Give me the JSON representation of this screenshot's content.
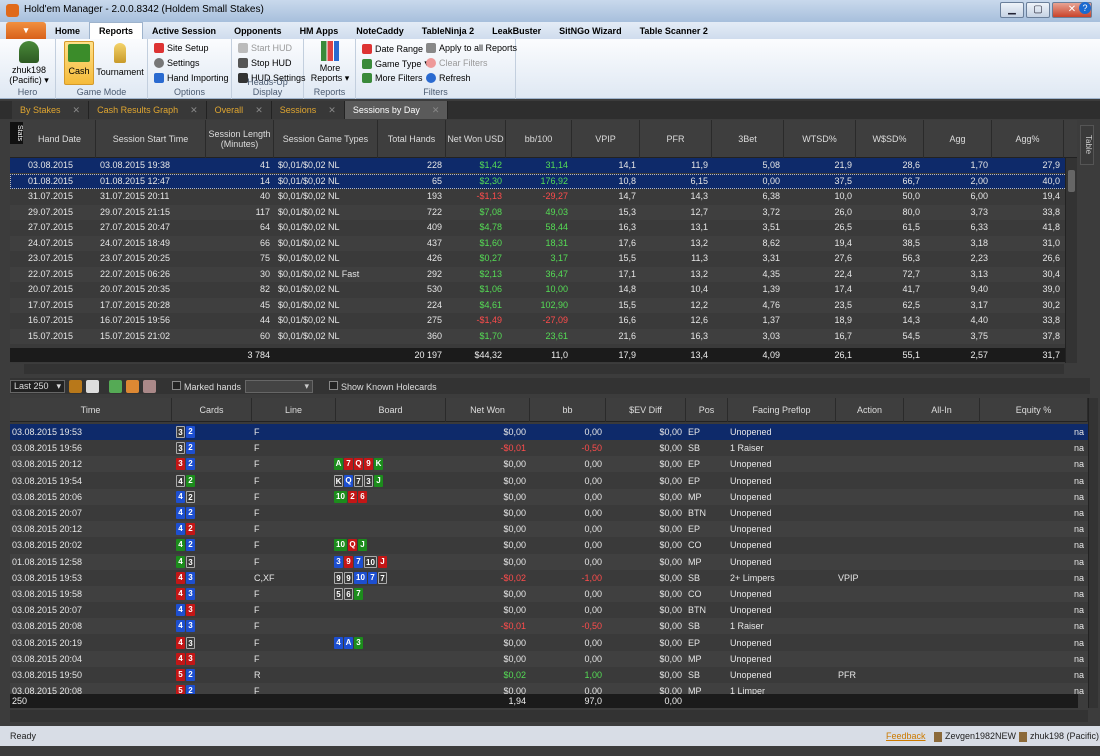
{
  "window": {
    "title": "Hold'em Manager - 2.0.0.8342 (Holdem Small Stakes)",
    "min": "▁",
    "max": "▢",
    "close": "✕"
  },
  "menu_tabs": [
    "Home",
    "Reports",
    "Active Session",
    "Opponents",
    "HM Apps",
    "NoteCaddy",
    "TableNinja 2",
    "LeakBuster",
    "SitNGo Wizard",
    "Table Scanner 2"
  ],
  "active_menu_tab": "Reports",
  "help_label": "?",
  "app_button_label": "▾",
  "ribbon": {
    "hero": {
      "name": "zhuk198",
      "site": "(Pacific)",
      "caption": "Hero"
    },
    "game_mode": {
      "cash": "Cash",
      "tournament": "Tournament",
      "caption": "Game Mode"
    },
    "options": {
      "site_setup": "Site Setup",
      "settings": "Settings",
      "hand_importing": "Hand Importing",
      "caption": "Options"
    },
    "hud": {
      "start": "Start HUD",
      "stop": "Stop HUD",
      "settings": "HUD Settings",
      "caption": "Heads-Up Display"
    },
    "reports": {
      "more": "More",
      "reports_label": "Reports",
      "caption": "Reports"
    },
    "filters": {
      "date_range": "Date Range",
      "game_type": "Game Type",
      "more_filters": "More Filters",
      "apply_all": "Apply to all Reports",
      "clear": "Clear Filters",
      "refresh": "Refresh",
      "caption": "Filters"
    }
  },
  "doc_tabs": [
    "By Stakes",
    "Cash Results Graph",
    "Overall",
    "Sessions",
    "Sessions by Day"
  ],
  "active_doc_tab": "Sessions by Day",
  "stats_label": "Stats",
  "table_label": "Table",
  "sessions_table": {
    "columns": [
      "Hand Date",
      "Session Start Time",
      "Session Length (Minutes)",
      "Session Game Types",
      "Total Hands",
      "Net Won USD",
      "bb/100",
      "VPIP",
      "PFR",
      "3Bet",
      "WTSD%",
      "W$SD%",
      "Agg",
      "Agg%"
    ],
    "rows": [
      [
        "03.08.2015",
        "03.08.2015 19:38",
        "41",
        "$0,01/$0,02 NL",
        "228",
        "$1,42",
        "31,14",
        "14,1",
        "11,9",
        "5,08",
        "21,9",
        "28,6",
        "1,70",
        "27,9"
      ],
      [
        "01.08.2015",
        "01.08.2015 12:47",
        "14",
        "$0,01/$0,02 NL",
        "65",
        "$2,30",
        "176,92",
        "10,8",
        "6,15",
        "0,00",
        "37,5",
        "66,7",
        "2,00",
        "40,0"
      ],
      [
        "31.07.2015",
        "31.07.2015 20:11",
        "40",
        "$0,01/$0,02 NL",
        "193",
        "-$1,13",
        "-29,27",
        "14,7",
        "14,3",
        "6,38",
        "10,0",
        "50,0",
        "6,00",
        "19,4"
      ],
      [
        "29.07.2015",
        "29.07.2015 21:15",
        "117",
        "$0,01/$0,02 NL",
        "722",
        "$7,08",
        "49,03",
        "15,3",
        "12,7",
        "3,72",
        "26,0",
        "80,0",
        "3,73",
        "33,8"
      ],
      [
        "27.07.2015",
        "27.07.2015 20:47",
        "64",
        "$0,01/$0,02 NL",
        "409",
        "$4,78",
        "58,44",
        "16,3",
        "13,1",
        "3,51",
        "26,5",
        "61,5",
        "6,33",
        "41,8"
      ],
      [
        "24.07.2015",
        "24.07.2015 18:49",
        "66",
        "$0,01/$0,02 NL",
        "437",
        "$1,60",
        "18,31",
        "17,6",
        "13,2",
        "8,62",
        "19,4",
        "38,5",
        "3,18",
        "31,0"
      ],
      [
        "23.07.2015",
        "23.07.2015 20:25",
        "75",
        "$0,01/$0,02 NL",
        "426",
        "$0,27",
        "3,17",
        "15,5",
        "11,3",
        "3,31",
        "27,6",
        "56,3",
        "2,23",
        "26,6"
      ],
      [
        "22.07.2015",
        "22.07.2015 06:26",
        "30",
        "$0,01/$0,02 NL Fast",
        "292",
        "$2,13",
        "36,47",
        "17,1",
        "13,2",
        "4,35",
        "22,4",
        "72,7",
        "3,13",
        "30,4"
      ],
      [
        "20.07.2015",
        "20.07.2015 20:35",
        "82",
        "$0,01/$0,02 NL",
        "530",
        "$1,06",
        "10,00",
        "14,8",
        "10,4",
        "1,39",
        "17,4",
        "41,7",
        "9,40",
        "39,0"
      ],
      [
        "17.07.2015",
        "17.07.2015 20:28",
        "45",
        "$0,01/$0,02 NL",
        "224",
        "$4,61",
        "102,90",
        "15,5",
        "12,2",
        "4,76",
        "23,5",
        "62,5",
        "3,17",
        "30,2"
      ],
      [
        "16.07.2015",
        "16.07.2015 19:56",
        "44",
        "$0,01/$0,02 NL",
        "275",
        "-$1,49",
        "-27,09",
        "16,6",
        "12,6",
        "1,37",
        "18,9",
        "14,3",
        "4,40",
        "33,8"
      ],
      [
        "15.07.2015",
        "15.07.2015 21:02",
        "60",
        "$0,01/$0,02 NL",
        "360",
        "$1,70",
        "23,61",
        "21,6",
        "16,3",
        "3,03",
        "16,7",
        "54,5",
        "3,75",
        "37,8"
      ]
    ],
    "totals": [
      "",
      "",
      "3 784",
      "",
      "20 197",
      "$44,32",
      "11,0",
      "17,9",
      "13,4",
      "4,09",
      "26,1",
      "55,1",
      "2,57",
      "31,7"
    ]
  },
  "hands_toolbar": {
    "limit": "Last 250",
    "marked_hands": "Marked hands",
    "show_known": "Show Known Holecards"
  },
  "hands_table": {
    "columns": [
      "Time",
      "Cards",
      "Line",
      "Board",
      "Net Won",
      "bb",
      "$EV Diff",
      "Pos",
      "Facing Preflop",
      "Action",
      "All-In",
      "Equity %"
    ],
    "rows": [
      {
        "time": "03.08.2015 19:53",
        "cards": [
          [
            "3",
            "s"
          ],
          [
            "2",
            "d"
          ]
        ],
        "line": "F",
        "board": [],
        "net": "$0,00",
        "bb": "0,00",
        "ev": "$0,00",
        "pos": "EP",
        "facing": "Unopened",
        "action": "",
        "allin": "",
        "eq": "na"
      },
      {
        "time": "03.08.2015 19:56",
        "cards": [
          [
            "3",
            "s"
          ],
          [
            "2",
            "d"
          ]
        ],
        "line": "F",
        "board": [],
        "net": "-$0,01",
        "bb": "-0,50",
        "ev": "$0,00",
        "pos": "SB",
        "facing": "1 Raiser",
        "action": "",
        "allin": "",
        "eq": "na"
      },
      {
        "time": "03.08.2015 20:12",
        "cards": [
          [
            "3",
            "h"
          ],
          [
            "2",
            "d"
          ]
        ],
        "line": "F",
        "board": [
          [
            "A",
            "c2"
          ],
          [
            "7",
            "h"
          ],
          [
            "Q",
            "h"
          ],
          [
            "9",
            "h"
          ],
          [
            "K",
            "c2"
          ]
        ],
        "net": "$0,00",
        "bb": "0,00",
        "ev": "$0,00",
        "pos": "EP",
        "facing": "Unopened",
        "action": "",
        "allin": "",
        "eq": "na"
      },
      {
        "time": "03.08.2015 19:54",
        "cards": [
          [
            "4",
            "s"
          ],
          [
            "2",
            "c2"
          ]
        ],
        "line": "F",
        "board": [
          [
            "K",
            "s"
          ],
          [
            "Q",
            "d"
          ],
          [
            "7",
            "s"
          ],
          [
            "3",
            "s"
          ],
          [
            "J",
            "c2"
          ]
        ],
        "net": "$0,00",
        "bb": "0,00",
        "ev": "$0,00",
        "pos": "EP",
        "facing": "Unopened",
        "action": "",
        "allin": "",
        "eq": "na"
      },
      {
        "time": "03.08.2015 20:06",
        "cards": [
          [
            "4",
            "d"
          ],
          [
            "2",
            "s"
          ]
        ],
        "line": "F",
        "board": [
          [
            "10",
            "c2"
          ],
          [
            "2",
            "h"
          ],
          [
            "6",
            "h"
          ]
        ],
        "net": "$0,00",
        "bb": "0,00",
        "ev": "$0,00",
        "pos": "MP",
        "facing": "Unopened",
        "action": "",
        "allin": "",
        "eq": "na"
      },
      {
        "time": "03.08.2015 20:07",
        "cards": [
          [
            "4",
            "d"
          ],
          [
            "2",
            "d"
          ]
        ],
        "line": "F",
        "board": [],
        "net": "$0,00",
        "bb": "0,00",
        "ev": "$0,00",
        "pos": "BTN",
        "facing": "Unopened",
        "action": "",
        "allin": "",
        "eq": "na"
      },
      {
        "time": "03.08.2015 20:12",
        "cards": [
          [
            "4",
            "d"
          ],
          [
            "2",
            "h"
          ]
        ],
        "line": "F",
        "board": [],
        "net": "$0,00",
        "bb": "0,00",
        "ev": "$0,00",
        "pos": "EP",
        "facing": "Unopened",
        "action": "",
        "allin": "",
        "eq": "na"
      },
      {
        "time": "03.08.2015 20:02",
        "cards": [
          [
            "4",
            "c2"
          ],
          [
            "2",
            "d"
          ]
        ],
        "line": "F",
        "board": [
          [
            "10",
            "c2"
          ],
          [
            "Q",
            "h"
          ],
          [
            "J",
            "c2"
          ]
        ],
        "net": "$0,00",
        "bb": "0,00",
        "ev": "$0,00",
        "pos": "CO",
        "facing": "Unopened",
        "action": "",
        "allin": "",
        "eq": "na"
      },
      {
        "time": "01.08.2015 12:58",
        "cards": [
          [
            "4",
            "c2"
          ],
          [
            "3",
            "s"
          ]
        ],
        "line": "F",
        "board": [
          [
            "3",
            "d"
          ],
          [
            "9",
            "h"
          ],
          [
            "7",
            "d"
          ],
          [
            "10",
            "s"
          ],
          [
            "J",
            "h"
          ]
        ],
        "net": "$0,00",
        "bb": "0,00",
        "ev": "$0,00",
        "pos": "MP",
        "facing": "Unopened",
        "action": "",
        "allin": "",
        "eq": "na"
      },
      {
        "time": "03.08.2015 19:53",
        "cards": [
          [
            "4",
            "h"
          ],
          [
            "3",
            "d"
          ]
        ],
        "line": "C,XF",
        "board": [
          [
            "9",
            "s"
          ],
          [
            "9",
            "s"
          ],
          [
            "10",
            "d"
          ],
          [
            "7",
            "d"
          ],
          [
            "7",
            "s"
          ]
        ],
        "net": "-$0,02",
        "bb": "-1,00",
        "ev": "$0,00",
        "pos": "SB",
        "facing": "2+ Limpers",
        "action": "VPIP",
        "allin": "",
        "eq": "na"
      },
      {
        "time": "03.08.2015 19:58",
        "cards": [
          [
            "4",
            "h"
          ],
          [
            "3",
            "d"
          ]
        ],
        "line": "F",
        "board": [
          [
            "5",
            "s"
          ],
          [
            "6",
            "s"
          ],
          [
            "7",
            "c2"
          ]
        ],
        "net": "$0,00",
        "bb": "0,00",
        "ev": "$0,00",
        "pos": "CO",
        "facing": "Unopened",
        "action": "",
        "allin": "",
        "eq": "na"
      },
      {
        "time": "03.08.2015 20:07",
        "cards": [
          [
            "4",
            "d"
          ],
          [
            "3",
            "h"
          ]
        ],
        "line": "F",
        "board": [],
        "net": "$0,00",
        "bb": "0,00",
        "ev": "$0,00",
        "pos": "BTN",
        "facing": "Unopened",
        "action": "",
        "allin": "",
        "eq": "na"
      },
      {
        "time": "03.08.2015 20:08",
        "cards": [
          [
            "4",
            "d"
          ],
          [
            "3",
            "d"
          ]
        ],
        "line": "F",
        "board": [],
        "net": "-$0,01",
        "bb": "-0,50",
        "ev": "$0,00",
        "pos": "SB",
        "facing": "1 Raiser",
        "action": "",
        "allin": "",
        "eq": "na"
      },
      {
        "time": "03.08.2015 20:19",
        "cards": [
          [
            "4",
            "h"
          ],
          [
            "3",
            "s"
          ]
        ],
        "line": "F",
        "board": [
          [
            "4",
            "d"
          ],
          [
            "A",
            "d"
          ],
          [
            "3",
            "c2"
          ]
        ],
        "net": "$0,00",
        "bb": "0,00",
        "ev": "$0,00",
        "pos": "EP",
        "facing": "Unopened",
        "action": "",
        "allin": "",
        "eq": "na"
      },
      {
        "time": "03.08.2015 20:04",
        "cards": [
          [
            "4",
            "h"
          ],
          [
            "3",
            "h"
          ]
        ],
        "line": "F",
        "board": [],
        "net": "$0,00",
        "bb": "0,00",
        "ev": "$0,00",
        "pos": "MP",
        "facing": "Unopened",
        "action": "",
        "allin": "",
        "eq": "na"
      },
      {
        "time": "03.08.2015 19:50",
        "cards": [
          [
            "5",
            "h"
          ],
          [
            "2",
            "d"
          ]
        ],
        "line": "R",
        "board": [],
        "net": "$0,02",
        "bb": "1,00",
        "ev": "$0,00",
        "pos": "SB",
        "facing": "Unopened",
        "action": "PFR",
        "allin": "",
        "eq": "na"
      },
      {
        "time": "03.08.2015 20:08",
        "cards": [
          [
            "5",
            "h"
          ],
          [
            "2",
            "d"
          ]
        ],
        "line": "F",
        "board": [],
        "net": "$0,00",
        "bb": "0,00",
        "ev": "$0,00",
        "pos": "MP",
        "facing": "1 Limper",
        "action": "",
        "allin": "",
        "eq": "na"
      }
    ],
    "totals": {
      "count": "250",
      "net": "1,94",
      "bb": "97,0",
      "ev": "0,00"
    }
  },
  "status": {
    "ready": "Ready",
    "feedback": "Feedback",
    "player1": "Zevgen1982NEW",
    "player2": "zhuk198 (Pacific)"
  }
}
